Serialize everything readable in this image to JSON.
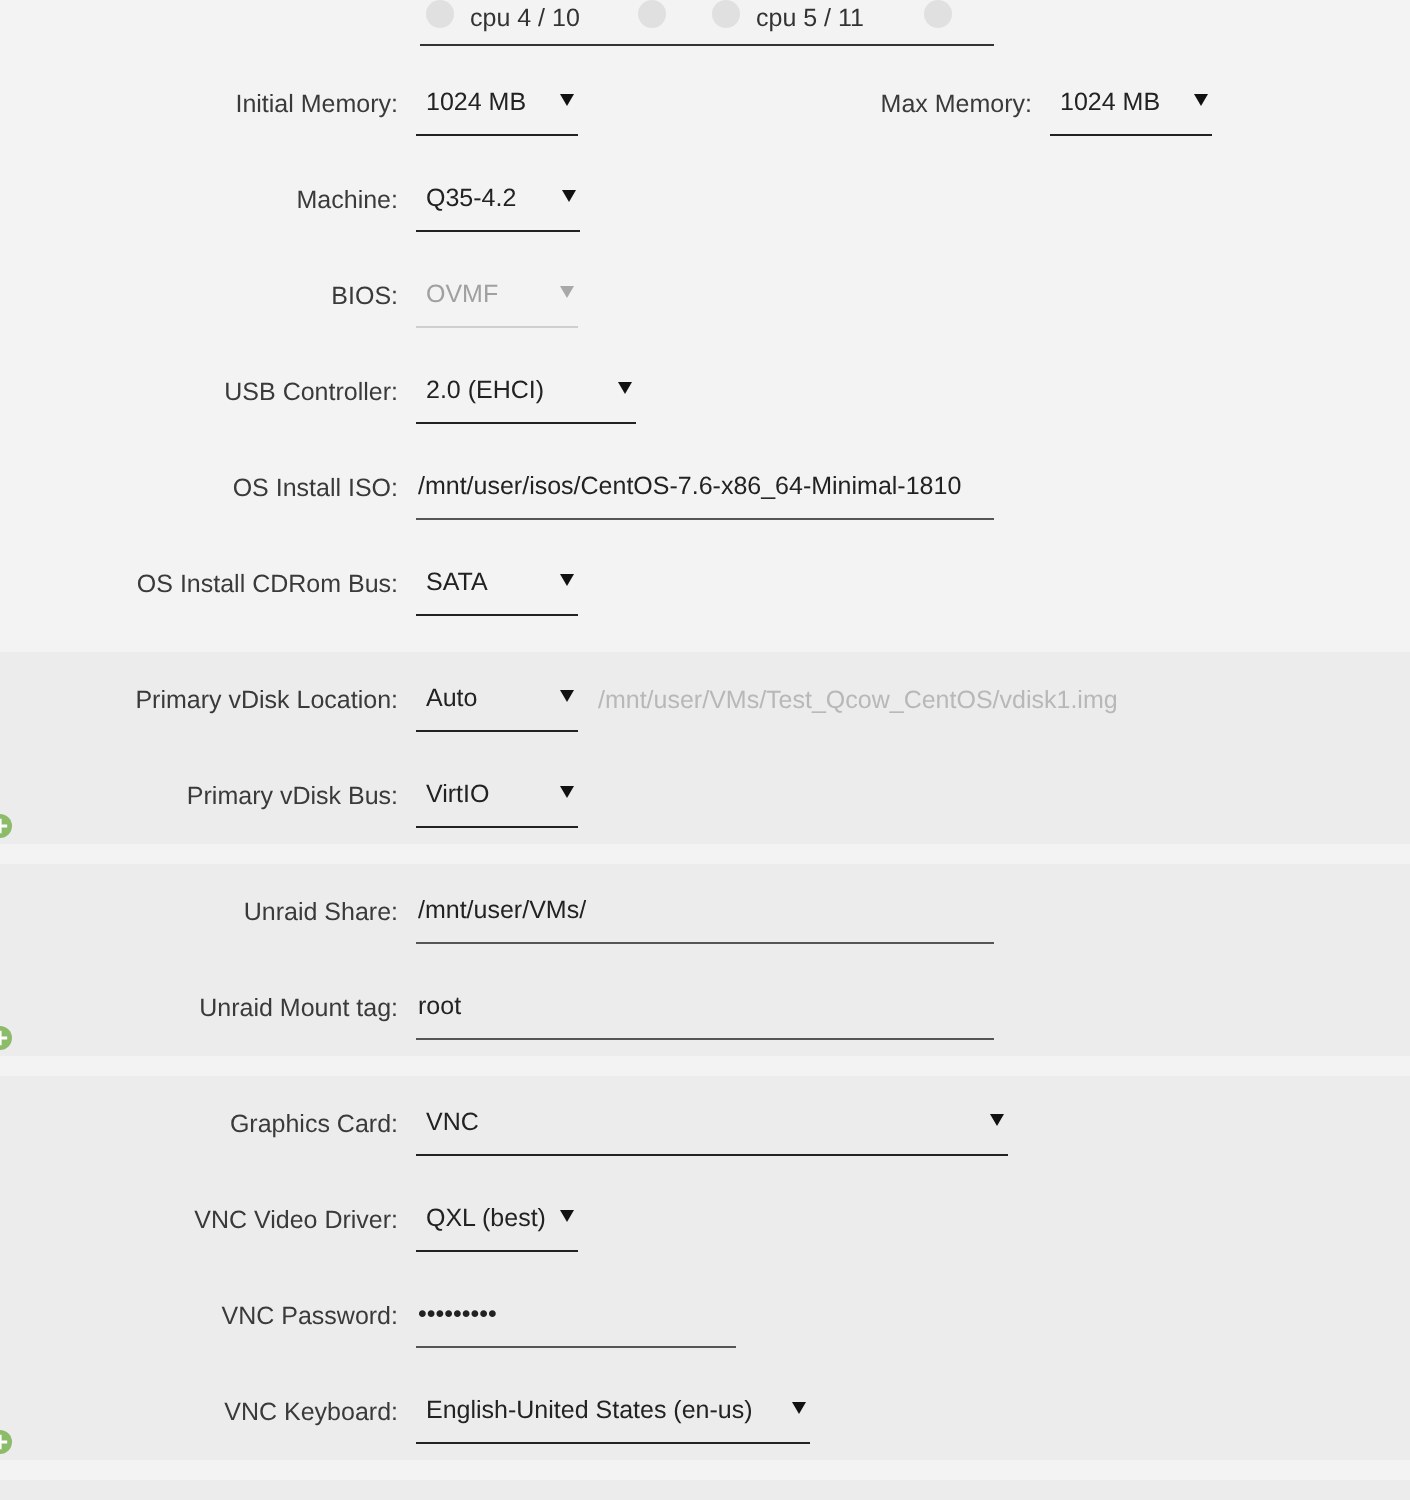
{
  "cpu_pinning": [
    {
      "label": "cpu 4 / 10",
      "checks": [
        {
          "checked": false
        },
        {
          "checked": false
        }
      ]
    },
    {
      "label": "cpu 5 / 11",
      "checks": [
        {
          "checked": false
        },
        {
          "checked": false
        }
      ]
    }
  ],
  "sections": [
    {
      "add_button": false,
      "rows": [
        {
          "fields": [
            {
              "label": "Initial Memory:",
              "kind": "select",
              "value": "1024 MB",
              "disabled": false
            },
            {
              "label": "Max Memory:",
              "kind": "select",
              "value": "1024 MB",
              "disabled": false
            }
          ]
        },
        {
          "fields": [
            {
              "label": "Machine:",
              "kind": "select",
              "value": "Q35-4.2",
              "disabled": false
            }
          ]
        },
        {
          "fields": [
            {
              "label": "BIOS:",
              "kind": "select",
              "value": "OVMF",
              "disabled": true
            }
          ]
        },
        {
          "fields": [
            {
              "label": "USB Controller:",
              "kind": "select",
              "value": "2.0 (EHCI)",
              "disabled": false
            }
          ]
        },
        {
          "fields": [
            {
              "label": "OS Install ISO:",
              "kind": "input",
              "value": "/mnt/user/isos/CentOS-7.6-x86_64-Minimal-1810",
              "disabled": false
            }
          ]
        },
        {
          "fields": [
            {
              "label": "OS Install CDRom Bus:",
              "kind": "select",
              "value": "SATA",
              "disabled": false
            }
          ]
        }
      ]
    },
    {
      "add_button": true,
      "rows": [
        {
          "fields": [
            {
              "label": "Primary vDisk Location:",
              "kind": "select",
              "value": "Auto",
              "disabled": false,
              "note": "/mnt/user/VMs/Test_Qcow_CentOS/vdisk1.img"
            }
          ]
        },
        {
          "fields": [
            {
              "label": "Primary vDisk Bus:",
              "kind": "select",
              "value": "VirtIO",
              "disabled": false
            }
          ]
        }
      ]
    },
    {
      "add_button": true,
      "rows": [
        {
          "fields": [
            {
              "label": "Unraid Share:",
              "kind": "input",
              "value": "/mnt/user/VMs/",
              "disabled": false
            }
          ]
        },
        {
          "fields": [
            {
              "label": "Unraid Mount tag:",
              "kind": "input",
              "value": "root",
              "disabled": false
            }
          ]
        }
      ]
    },
    {
      "add_button": true,
      "rows": [
        {
          "fields": [
            {
              "label": "Graphics Card:",
              "kind": "select",
              "value": "VNC",
              "disabled": false
            }
          ]
        },
        {
          "fields": [
            {
              "label": "VNC Video Driver:",
              "kind": "select",
              "value": "QXL (best)",
              "disabled": false
            }
          ]
        },
        {
          "fields": [
            {
              "label": "VNC Password:",
              "kind": "password",
              "value": "•••••••••",
              "disabled": false
            }
          ]
        },
        {
          "fields": [
            {
              "label": "VNC Keyboard:",
              "kind": "select",
              "value": "English-United States (en-us)",
              "disabled": false
            }
          ]
        }
      ]
    }
  ]
}
